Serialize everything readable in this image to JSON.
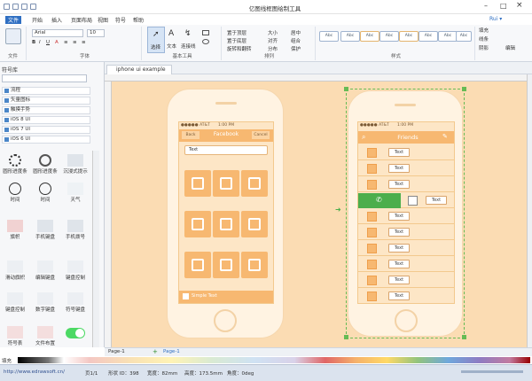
{
  "window": {
    "title": "亿图线框图绘制工具"
  },
  "menu": [
    "文件",
    "开始",
    "插入",
    "页面布局",
    "视图",
    "符号",
    "帮助"
  ],
  "ribbon": {
    "font_name": "Arial",
    "font_size": "10",
    "groups": [
      "文件",
      "字体",
      "基本工具",
      "排列",
      "样式"
    ],
    "tools": {
      "select": "选择",
      "text": "文本",
      "connector": "连接线"
    },
    "arrange": [
      "置于顶层",
      "置于底层",
      "旋转和翻转",
      "对齐",
      "分布",
      "组合",
      "取消",
      "保护",
      "大小",
      "居中"
    ],
    "style_boxes": [
      "Abc",
      "Abc",
      "Abc",
      "Abc",
      "Abc",
      "Abc",
      "Abc",
      "Abc"
    ],
    "right": [
      "填充",
      "线条",
      "阴影",
      "编辑"
    ]
  },
  "library": {
    "title": "符号库",
    "categories": [
      "流程",
      "矢量图标",
      "触摸手势",
      "iOS 8 UI",
      "iOS 7 UI",
      "iOS 6 UI"
    ],
    "shapes": [
      [
        "圆形进度条",
        "圆形进度条",
        "沉浸式提示"
      ],
      [
        "时间",
        "时间",
        "天气"
      ],
      [
        "旗帜",
        "手机键盘",
        "手机拨号"
      ],
      [
        "滑动旗帜",
        "编辑键盘",
        "键盘控制"
      ],
      [
        "键盘控制",
        "数字键盘",
        "符号键盘"
      ],
      [
        "符号表",
        "文件布置",
        ""
      ]
    ]
  },
  "tab": {
    "name": "iphone ui example"
  },
  "phone1": {
    "carrier": "●●●●● AT&T",
    "time": "1:00 PM",
    "btn_back": "Back",
    "title": "Facebook",
    "btn_cancel": "Cancel",
    "search_text": "Text",
    "footer_text": "Simple Text"
  },
  "phone2": {
    "carrier": "●●●●● AT&T",
    "time": "1:00 PM",
    "title": "Friends",
    "rows": [
      "Text",
      "Text",
      "Text",
      "Text",
      "Text",
      "Text",
      "Text",
      "Text",
      "Text",
      "Text"
    ]
  },
  "pages": {
    "current": "Page-1",
    "tab": "Page-1"
  },
  "status": {
    "url": "http://www.edrawsoft.cn/",
    "page": "页1/1",
    "shape_id": "形状 ID：398",
    "width": "宽度：82mm",
    "height": "高度：173.5mm",
    "angle": "角度：0deg",
    "fill_label": "填充"
  }
}
